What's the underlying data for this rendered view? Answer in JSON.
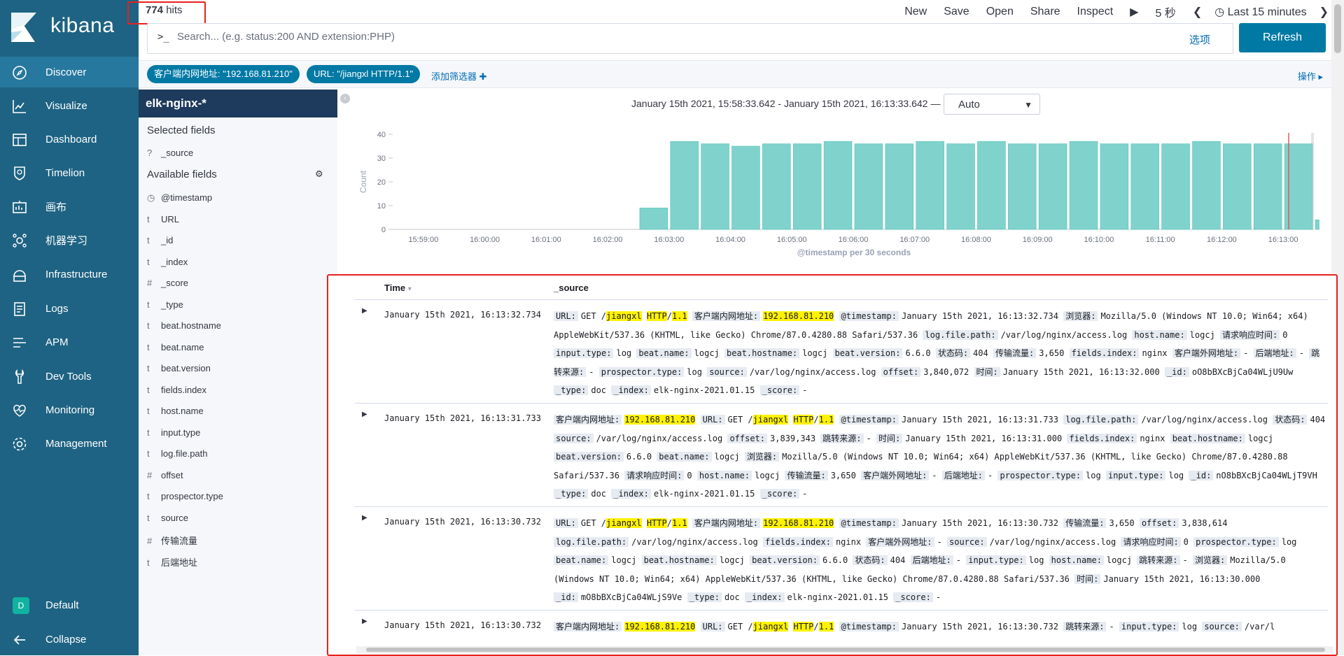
{
  "app": {
    "brand": "kibana"
  },
  "sidebar": {
    "items": [
      {
        "label": "Discover",
        "icon": "compass-icon"
      },
      {
        "label": "Visualize",
        "icon": "chart-icon"
      },
      {
        "label": "Dashboard",
        "icon": "dashboard-icon"
      },
      {
        "label": "Timelion",
        "icon": "shield-icon"
      },
      {
        "label": "画布",
        "icon": "canvas-icon"
      },
      {
        "label": "机器学习",
        "icon": "ml-icon"
      },
      {
        "label": "Infrastructure",
        "icon": "infrastructure-icon"
      },
      {
        "label": "Logs",
        "icon": "logs-icon"
      },
      {
        "label": "APM",
        "icon": "apm-icon"
      },
      {
        "label": "Dev Tools",
        "icon": "wrench-icon"
      },
      {
        "label": "Monitoring",
        "icon": "heartbeat-icon"
      },
      {
        "label": "Management",
        "icon": "gear-icon"
      }
    ],
    "space": {
      "badge": "D",
      "label": "Default"
    },
    "collapse": "Collapse"
  },
  "topbar": {
    "hits_count": "774",
    "hits_label": "hits",
    "menu": {
      "new": "New",
      "save": "Save",
      "open": "Open",
      "share": "Share",
      "inspect": "Inspect"
    },
    "refresh_interval": "5 秒",
    "time_label": "Last 15 minutes"
  },
  "query": {
    "prompt": ">_",
    "placeholder": "Search... (e.g. status:200 AND extension:PHP)",
    "options": "选项",
    "refresh": "Refresh"
  },
  "filters": {
    "pills": [
      "客户端内网地址: \"192.168.81.210\"",
      "URL: \"/jiangxl HTTP/1.1\""
    ],
    "add": "添加筛选器",
    "actions": "操作"
  },
  "fields_panel": {
    "index": "elk-nginx-*",
    "selected_heading": "Selected fields",
    "selected": [
      {
        "type": "?",
        "name": "_source"
      }
    ],
    "available_heading": "Available fields",
    "available": [
      {
        "type": "◷",
        "name": "@timestamp"
      },
      {
        "type": "t",
        "name": "URL"
      },
      {
        "type": "t",
        "name": "_id"
      },
      {
        "type": "t",
        "name": "_index"
      },
      {
        "type": "#",
        "name": "_score"
      },
      {
        "type": "t",
        "name": "_type"
      },
      {
        "type": "t",
        "name": "beat.hostname"
      },
      {
        "type": "t",
        "name": "beat.name"
      },
      {
        "type": "t",
        "name": "beat.version"
      },
      {
        "type": "t",
        "name": "fields.index"
      },
      {
        "type": "t",
        "name": "host.name"
      },
      {
        "type": "t",
        "name": "input.type"
      },
      {
        "type": "t",
        "name": "log.file.path"
      },
      {
        "type": "#",
        "name": "offset"
      },
      {
        "type": "t",
        "name": "prospector.type"
      },
      {
        "type": "t",
        "name": "source"
      },
      {
        "type": "#",
        "name": "传输流量"
      },
      {
        "type": "t",
        "name": "后端地址"
      }
    ]
  },
  "histogram": {
    "range": "January 15th 2021, 15:58:33.642 - January 15th 2021, 16:13:33.642 —",
    "interval": "Auto"
  },
  "chart_data": {
    "type": "bar",
    "color": "#7fd3cc",
    "ylabel": "Count",
    "xlabel": "@timestamp per 30 seconds",
    "ylim": [
      0,
      40
    ],
    "yticks": [
      0,
      10,
      20,
      30,
      40
    ],
    "xtick_labels": [
      "15:59:00",
      "16:00:00",
      "16:01:00",
      "16:02:00",
      "16:03:00",
      "16:04:00",
      "16:05:00",
      "16:06:00",
      "16:07:00",
      "16:08:00",
      "16:09:00",
      "16:10:00",
      "16:11:00",
      "16:12:00",
      "16:13:00"
    ],
    "categories": [
      "16:02:30",
      "16:03:00",
      "16:03:30",
      "16:04:00",
      "16:04:30",
      "16:05:00",
      "16:05:30",
      "16:06:00",
      "16:06:30",
      "16:07:00",
      "16:07:30",
      "16:08:00",
      "16:08:30",
      "16:09:00",
      "16:09:30",
      "16:10:00",
      "16:10:30",
      "16:11:00",
      "16:11:30",
      "16:12:00",
      "16:12:30",
      "16:13:00",
      "16:13:30"
    ],
    "values": [
      9,
      37,
      36,
      35,
      36,
      36,
      37,
      36,
      36,
      37,
      36,
      37,
      36,
      36,
      37,
      36,
      36,
      36,
      37,
      36,
      36,
      36,
      4
    ]
  },
  "table": {
    "time_header": "Time",
    "source_header": "_source",
    "rows": [
      {
        "time": "January 15th 2021, 16:13:32.734"
      },
      {
        "time": "January 15th 2021, 16:13:31.733"
      },
      {
        "time": "January 15th 2021, 16:13:30.732"
      },
      {
        "time": "January 15th 2021, 16:13:30.732"
      }
    ],
    "docs": [
      [
        {
          "k": "URL:",
          "v": [
            {
              "t": "GET /"
            },
            {
              "t": "jiangxl",
              "h": true
            },
            {
              "t": " "
            },
            {
              "t": "HTTP",
              "h": true
            },
            {
              "t": "/"
            },
            {
              "t": "1.1",
              "h": true
            }
          ]
        },
        {
          "k": "客户端内网地址:",
          "v": [
            {
              "t": "192.168.81.210",
              "h": true
            }
          ]
        },
        {
          "k": "@timestamp:",
          "v": [
            {
              "t": "January 15th 2021, 16:13:32.734"
            }
          ]
        },
        {
          "k": "浏览器:",
          "v": [
            {
              "t": "Mozilla/5.0 (Windows NT 10.0; Win64; x64) AppleWebKit/537.36 (KHTML, like Gecko) Chrome/87.0.4280.88 Safari/537.36"
            }
          ]
        },
        {
          "k": "log.file.path:",
          "v": [
            {
              "t": "/var/log/nginx/access.log"
            }
          ]
        },
        {
          "k": "host.name:",
          "v": [
            {
              "t": "logcj"
            }
          ]
        },
        {
          "k": "请求响应时间:",
          "v": [
            {
              "t": "0"
            }
          ]
        },
        {
          "k": "input.type:",
          "v": [
            {
              "t": "log"
            }
          ]
        },
        {
          "k": "beat.name:",
          "v": [
            {
              "t": "logcj"
            }
          ]
        },
        {
          "k": "beat.hostname:",
          "v": [
            {
              "t": "logcj"
            }
          ]
        },
        {
          "k": "beat.version:",
          "v": [
            {
              "t": "6.6.0"
            }
          ]
        },
        {
          "k": "状态码:",
          "v": [
            {
              "t": "404"
            }
          ]
        },
        {
          "k": "传输流量:",
          "v": [
            {
              "t": "3,650"
            }
          ]
        },
        {
          "k": "fields.index:",
          "v": [
            {
              "t": "nginx"
            }
          ]
        },
        {
          "k": "客户端外网地址:",
          "v": [
            {
              "t": "-"
            }
          ]
        },
        {
          "k": "后端地址:",
          "v": [
            {
              "t": "-"
            }
          ]
        },
        {
          "k": "跳转来源:",
          "v": [
            {
              "t": "-"
            }
          ]
        },
        {
          "k": "prospector.type:",
          "v": [
            {
              "t": "log"
            }
          ]
        },
        {
          "k": "source:",
          "v": [
            {
              "t": "/var/log/nginx/access.log"
            }
          ]
        },
        {
          "k": "offset:",
          "v": [
            {
              "t": "3,840,072"
            }
          ]
        },
        {
          "k": "时间:",
          "v": [
            {
              "t": "January 15th 2021, 16:13:32.000"
            }
          ]
        },
        {
          "k": "_id:",
          "v": [
            {
              "t": "oO8bBXcBjCa04WLjU9Uw"
            }
          ]
        },
        {
          "k": "_type:",
          "v": [
            {
              "t": "doc"
            }
          ]
        },
        {
          "k": "_index:",
          "v": [
            {
              "t": "elk-nginx-2021.01.15"
            }
          ]
        },
        {
          "k": "_score:",
          "v": [
            {
              "t": "-"
            }
          ]
        }
      ],
      [
        {
          "k": "客户端内网地址:",
          "v": [
            {
              "t": "192.168.81.210",
              "h": true
            }
          ]
        },
        {
          "k": "URL:",
          "v": [
            {
              "t": "GET /"
            },
            {
              "t": "jiangxl",
              "h": true
            },
            {
              "t": " "
            },
            {
              "t": "HTTP",
              "h": true
            },
            {
              "t": "/"
            },
            {
              "t": "1.1",
              "h": true
            }
          ]
        },
        {
          "k": "@timestamp:",
          "v": [
            {
              "t": "January 15th 2021, 16:13:31.733"
            }
          ]
        },
        {
          "k": "log.file.path:",
          "v": [
            {
              "t": "/var/log/nginx/access.log"
            }
          ]
        },
        {
          "k": "状态码:",
          "v": [
            {
              "t": "404"
            }
          ]
        },
        {
          "k": "source:",
          "v": [
            {
              "t": "/var/log/nginx/access.log"
            }
          ]
        },
        {
          "k": "offset:",
          "v": [
            {
              "t": "3,839,343"
            }
          ]
        },
        {
          "k": "跳转来源:",
          "v": [
            {
              "t": "-"
            }
          ]
        },
        {
          "k": "时间:",
          "v": [
            {
              "t": "January 15th 2021, 16:13:31.000"
            }
          ]
        },
        {
          "k": "fields.index:",
          "v": [
            {
              "t": "nginx"
            }
          ]
        },
        {
          "k": "beat.hostname:",
          "v": [
            {
              "t": "logcj"
            }
          ]
        },
        {
          "k": "beat.version:",
          "v": [
            {
              "t": "6.6.0"
            }
          ]
        },
        {
          "k": "beat.name:",
          "v": [
            {
              "t": "logcj"
            }
          ]
        },
        {
          "k": "浏览器:",
          "v": [
            {
              "t": "Mozilla/5.0 (Windows NT 10.0; Win64; x64) AppleWebKit/537.36 (KHTML, like Gecko) Chrome/87.0.4280.88 Safari/537.36"
            }
          ]
        },
        {
          "k": "请求响应时间:",
          "v": [
            {
              "t": "0"
            }
          ]
        },
        {
          "k": "host.name:",
          "v": [
            {
              "t": "logcj"
            }
          ]
        },
        {
          "k": "传输流量:",
          "v": [
            {
              "t": "3,650"
            }
          ]
        },
        {
          "k": "客户端外网地址:",
          "v": [
            {
              "t": "-"
            }
          ]
        },
        {
          "k": "后端地址:",
          "v": [
            {
              "t": "-"
            }
          ]
        },
        {
          "k": "prospector.type:",
          "v": [
            {
              "t": "log"
            }
          ]
        },
        {
          "k": "input.type:",
          "v": [
            {
              "t": "log"
            }
          ]
        },
        {
          "k": "_id:",
          "v": [
            {
              "t": "nO8bBXcBjCa04WLjT9VH"
            }
          ]
        },
        {
          "k": "_type:",
          "v": [
            {
              "t": "doc"
            }
          ]
        },
        {
          "k": "_index:",
          "v": [
            {
              "t": "elk-nginx-2021.01.15"
            }
          ]
        },
        {
          "k": "_score:",
          "v": [
            {
              "t": "-"
            }
          ]
        }
      ],
      [
        {
          "k": "URL:",
          "v": [
            {
              "t": "GET /"
            },
            {
              "t": "jiangxl",
              "h": true
            },
            {
              "t": " "
            },
            {
              "t": "HTTP",
              "h": true
            },
            {
              "t": "/"
            },
            {
              "t": "1.1",
              "h": true
            }
          ]
        },
        {
          "k": "客户端内网地址:",
          "v": [
            {
              "t": "192.168.81.210",
              "h": true
            }
          ]
        },
        {
          "k": "@timestamp:",
          "v": [
            {
              "t": "January 15th 2021, 16:13:30.732"
            }
          ]
        },
        {
          "k": "传输流量:",
          "v": [
            {
              "t": "3,650"
            }
          ]
        },
        {
          "k": "offset:",
          "v": [
            {
              "t": "3,838,614"
            }
          ]
        },
        {
          "k": "log.file.path:",
          "v": [
            {
              "t": "/var/log/nginx/access.log"
            }
          ]
        },
        {
          "k": "fields.index:",
          "v": [
            {
              "t": "nginx"
            }
          ]
        },
        {
          "k": "客户端外网地址:",
          "v": [
            {
              "t": "-"
            }
          ]
        },
        {
          "k": "source:",
          "v": [
            {
              "t": "/var/log/nginx/access.log"
            }
          ]
        },
        {
          "k": "请求响应时间:",
          "v": [
            {
              "t": "0"
            }
          ]
        },
        {
          "k": "prospector.type:",
          "v": [
            {
              "t": "log"
            }
          ]
        },
        {
          "k": "beat.name:",
          "v": [
            {
              "t": "logcj"
            }
          ]
        },
        {
          "k": "beat.hostname:",
          "v": [
            {
              "t": "logcj"
            }
          ]
        },
        {
          "k": "beat.version:",
          "v": [
            {
              "t": "6.6.0"
            }
          ]
        },
        {
          "k": "状态码:",
          "v": [
            {
              "t": "404"
            }
          ]
        },
        {
          "k": "后端地址:",
          "v": [
            {
              "t": "-"
            }
          ]
        },
        {
          "k": "input.type:",
          "v": [
            {
              "t": "log"
            }
          ]
        },
        {
          "k": "host.name:",
          "v": [
            {
              "t": "logcj"
            }
          ]
        },
        {
          "k": "跳转来源:",
          "v": [
            {
              "t": "-"
            }
          ]
        },
        {
          "k": "浏览器:",
          "v": [
            {
              "t": "Mozilla/5.0 (Windows NT 10.0; Win64; x64) AppleWebKit/537.36 (KHTML, like Gecko) Chrome/87.0.4280.88 Safari/537.36"
            }
          ]
        },
        {
          "k": "时间:",
          "v": [
            {
              "t": "January 15th 2021, 16:13:30.000"
            }
          ]
        },
        {
          "k": "_id:",
          "v": [
            {
              "t": "mO8bBXcBjCa04WLjS9Ve"
            }
          ]
        },
        {
          "k": "_type:",
          "v": [
            {
              "t": "doc"
            }
          ]
        },
        {
          "k": "_index:",
          "v": [
            {
              "t": "elk-nginx-2021.01.15"
            }
          ]
        },
        {
          "k": "_score:",
          "v": [
            {
              "t": "-"
            }
          ]
        }
      ],
      [
        {
          "k": "客户端内网地址:",
          "v": [
            {
              "t": "192.168.81.210",
              "h": true
            }
          ]
        },
        {
          "k": "URL:",
          "v": [
            {
              "t": "GET /"
            },
            {
              "t": "jiangxl",
              "h": true
            },
            {
              "t": " "
            },
            {
              "t": "HTTP",
              "h": true
            },
            {
              "t": "/"
            },
            {
              "t": "1.1",
              "h": true
            }
          ]
        },
        {
          "k": "@timestamp:",
          "v": [
            {
              "t": "January 15th 2021, 16:13:30.732"
            }
          ]
        },
        {
          "k": "跳转来源:",
          "v": [
            {
              "t": "-"
            }
          ]
        },
        {
          "k": "input.type:",
          "v": [
            {
              "t": "log"
            }
          ]
        },
        {
          "k": "source:",
          "v": [
            {
              "t": "/var/l"
            }
          ]
        }
      ]
    ]
  }
}
